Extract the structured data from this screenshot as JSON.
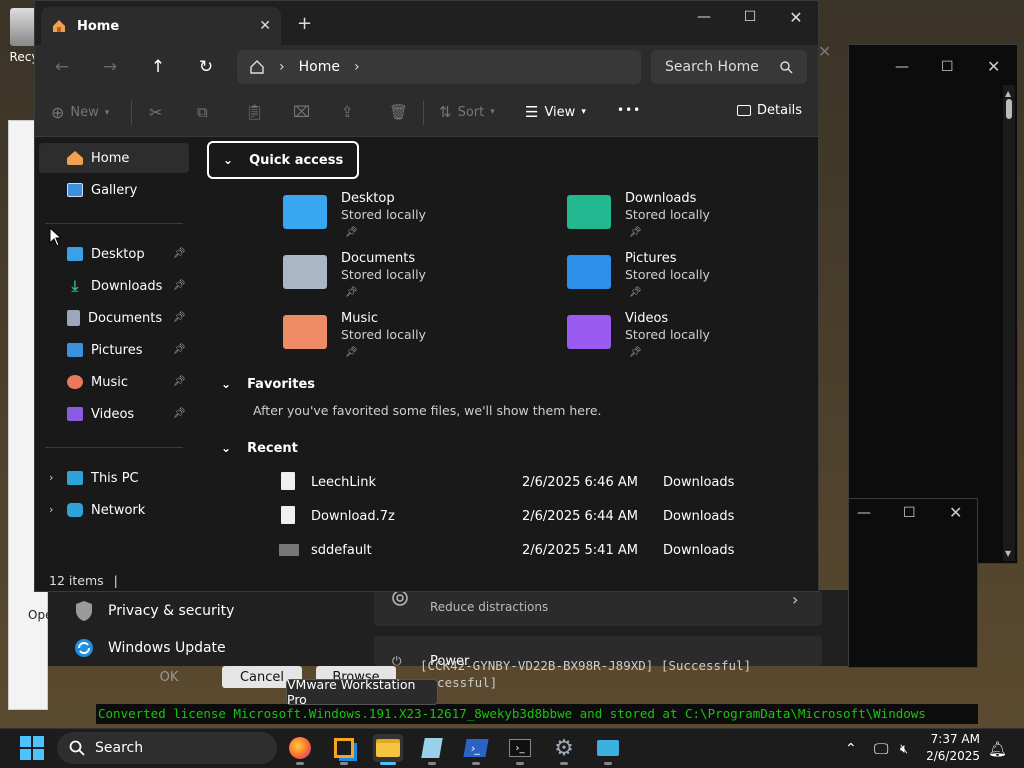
{
  "desktop": {
    "recycle_label": "Recy"
  },
  "explorer": {
    "tab_title": "Home",
    "new_tab": "+",
    "window_controls": {
      "minimize": "—",
      "maximize": "☐",
      "close": "✕"
    },
    "address": {
      "crumb": "Home"
    },
    "search_placeholder": "Search Home",
    "toolbar": {
      "new": "New",
      "sort": "Sort",
      "view": "View",
      "more": "•••",
      "details": "Details"
    },
    "sidebar": {
      "home": "Home",
      "gallery": "Gallery",
      "pinned": [
        {
          "label": "Desktop",
          "color": "#3aa0e8"
        },
        {
          "label": "Downloads",
          "color": "#2fb57d"
        },
        {
          "label": "Documents",
          "color": "#9aa8b8"
        },
        {
          "label": "Pictures",
          "color": "#3d8fe0"
        },
        {
          "label": "Music",
          "color": "#e8795c"
        },
        {
          "label": "Videos",
          "color": "#8a5ce0"
        }
      ],
      "this_pc": "This PC",
      "network": "Network"
    },
    "quick_access": {
      "title": "Quick access",
      "items": [
        {
          "name": "Desktop",
          "sub": "Stored locally",
          "color": "#38a6f0"
        },
        {
          "name": "Downloads",
          "sub": "Stored locally",
          "color": "#22b890"
        },
        {
          "name": "Documents",
          "sub": "Stored locally",
          "color": "#a9b6c6"
        },
        {
          "name": "Pictures",
          "sub": "Stored locally",
          "color": "#2e8fe8"
        },
        {
          "name": "Music",
          "sub": "Stored locally",
          "color": "#ee8a66"
        },
        {
          "name": "Videos",
          "sub": "Stored locally",
          "color": "#9a5cf0"
        }
      ]
    },
    "favorites": {
      "title": "Favorites",
      "empty_text": "After you've favorited some files, we'll show them here."
    },
    "recent": {
      "title": "Recent",
      "rows": [
        {
          "name": "LeechLink",
          "date": "2/6/2025 6:46 AM",
          "location": "Downloads"
        },
        {
          "name": "Download.7z",
          "date": "2/6/2025 6:44 AM",
          "location": "Downloads"
        },
        {
          "name": "sddefault",
          "date": "2/6/2025 5:41 AM",
          "location": "Downloads"
        }
      ]
    },
    "status": "12 items"
  },
  "settings": {
    "privacy": "Privacy & security",
    "update": "Windows Update",
    "focus_sub": "Reduce distractions",
    "power": "Power"
  },
  "dialog": {
    "ok": "OK",
    "cancel": "Cancel",
    "browse": "Browse"
  },
  "partial_left": {
    "ope": "Ope"
  },
  "terminal": {
    "line1": "[CCK42-GYNBY-VD22B-BX98R-J89XD] [Successful]",
    "line2": "uccessful]",
    "line3": "Converted license Microsoft.Windows.191.X23-12617_8wekyb3d8bbwe and stored at C:\\ProgramData\\Microsoft\\Windows"
  },
  "tooltip": "VMware Workstation Pro",
  "taskbar": {
    "search": "Search",
    "time": "7:37 AM",
    "date": "2/6/2025"
  }
}
